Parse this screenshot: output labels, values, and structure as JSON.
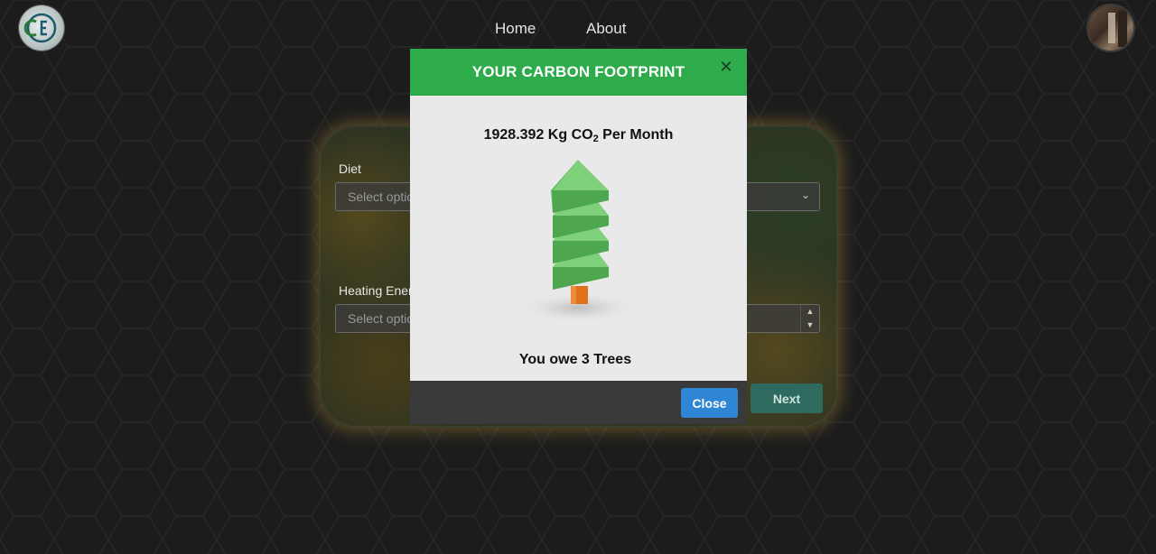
{
  "header": {
    "nav": [
      {
        "label": "Home"
      },
      {
        "label": "About"
      }
    ],
    "logo_icon": "app-logo",
    "avatar_icon": "user-avatar"
  },
  "form": {
    "diet_label": "Diet",
    "diet_placeholder": "Select option",
    "heating_label": "Heating Energy",
    "heating_placeholder": "Select option",
    "next_label": "Next"
  },
  "modal": {
    "title": "YOUR CARBON FOOTPRINT",
    "amount_value": "1928.392",
    "amount_unit": "Kg CO",
    "amount_sub": "2",
    "amount_period": "Per Month",
    "owe_text": "You owe 3 Trees",
    "close_label": "Close",
    "close_icon": "close-icon",
    "header_color": "#2eab4b",
    "button_color": "#2f86d4"
  }
}
